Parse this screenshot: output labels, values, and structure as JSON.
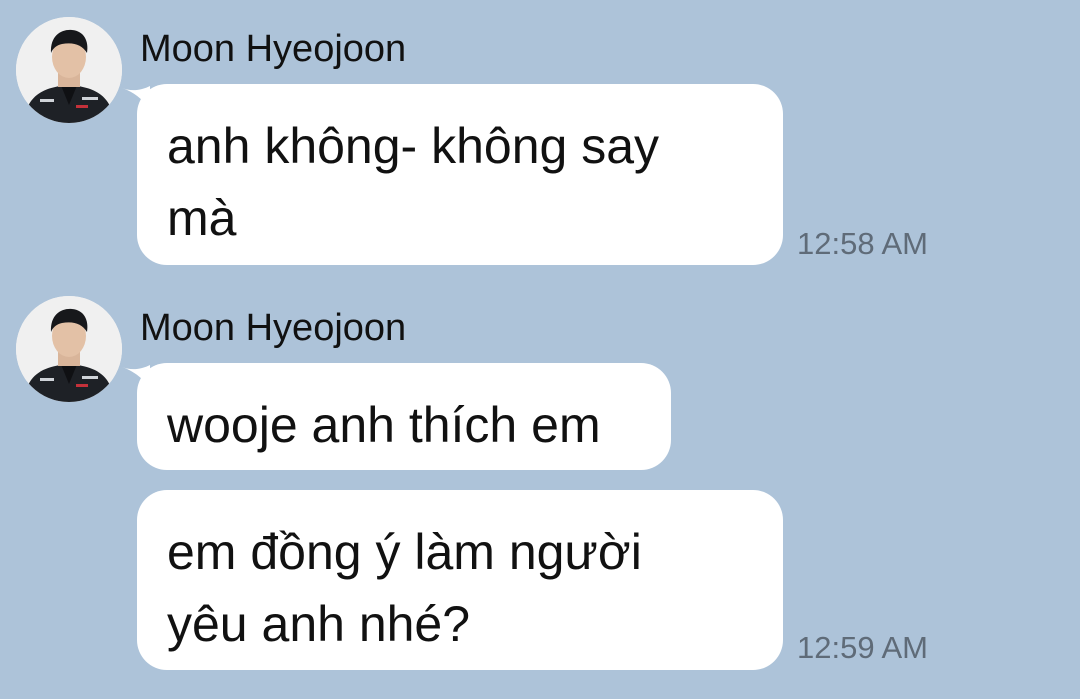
{
  "colors": {
    "background": "#adc3d9",
    "bubble": "#ffffff",
    "text": "#111111",
    "timestamp": "#5f6b78"
  },
  "messages": [
    {
      "sender": "Moon Hyeojoon",
      "avatar_icon": "profile-photo-icon",
      "bubbles": [
        {
          "lines": [
            "anh không- không say",
            "mà"
          ],
          "time": "12:58 AM"
        }
      ]
    },
    {
      "sender": "Moon Hyeojoon",
      "avatar_icon": "profile-photo-icon",
      "bubbles": [
        {
          "lines": [
            "wooje anh thích em"
          ]
        },
        {
          "lines": [
            "em đồng ý làm người",
            "yêu anh nhé?"
          ],
          "time": "12:59 AM"
        }
      ]
    }
  ]
}
